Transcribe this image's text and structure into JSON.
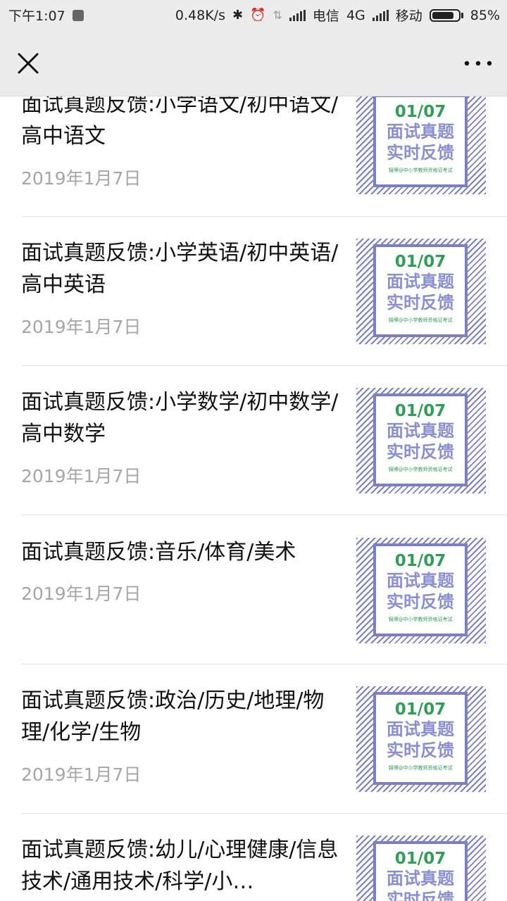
{
  "status_bar": {
    "time": "下午1:07",
    "speed": "0.48K/s",
    "carrier1": "电信",
    "network": "4G",
    "carrier2": "移动",
    "battery": "85%",
    "battery_level": 0.85
  },
  "nav": {
    "close_icon": "close-icon",
    "more_icon": "more-icon"
  },
  "thumbnail": {
    "date": "01/07",
    "line1": "面试真题",
    "line2": "实时反馈",
    "footer": "锦博@中小学教师资格证考试",
    "accent": "#7b80c4",
    "green": "#2f9e57"
  },
  "articles": [
    {
      "title": "面试真题反馈:小学语文/初中语文/高中语文",
      "date": "2019年1月7日"
    },
    {
      "title": "面试真题反馈:小学英语/初中英语/高中英语",
      "date": "2019年1月7日"
    },
    {
      "title": "面试真题反馈:小学数学/初中数学/高中数学",
      "date": "2019年1月7日"
    },
    {
      "title": "面试真题反馈:音乐/体育/美术",
      "date": "2019年1月7日"
    },
    {
      "title": "面试真题反馈:政治/历史/地理/物理/化学/生物",
      "date": "2019年1月7日"
    },
    {
      "title": "面试真题反馈:幼儿/心理健康/信息技术/通用技术/科学/小…",
      "date": ""
    }
  ]
}
